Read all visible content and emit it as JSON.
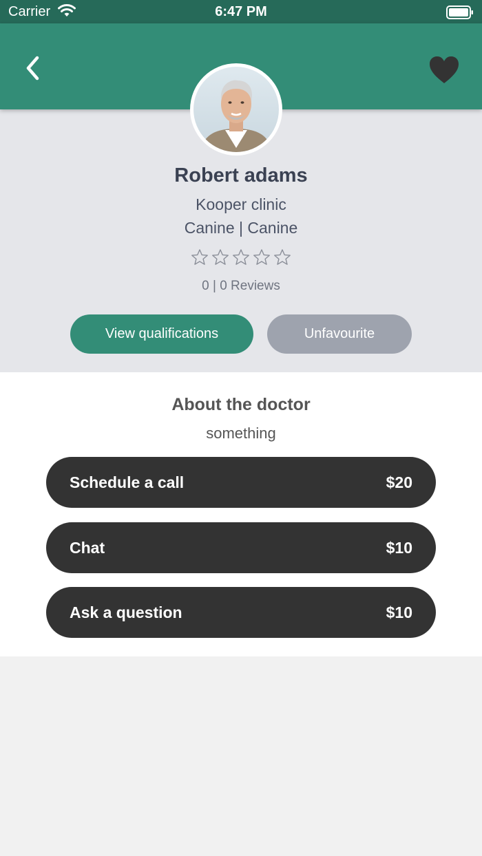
{
  "status_bar": {
    "carrier": "Carrier",
    "time": "6:47 PM"
  },
  "colors": {
    "accent": "#338d77",
    "status_bar": "#266a59",
    "dark_button": "#333333",
    "muted_button": "#9ea3ae"
  },
  "header": {
    "back_icon": "chevron-left-icon",
    "favourite_icon": "heart-icon"
  },
  "profile": {
    "name": "Robert adams",
    "clinic": "Kooper clinic",
    "specialty": "Canine | Canine",
    "rating": 0,
    "rating_max": 5,
    "reviews": "0 | 0 Reviews",
    "view_qualifications_label": "View qualifications",
    "unfavourite_label": "Unfavourite"
  },
  "about": {
    "title": "About the doctor",
    "text": "something"
  },
  "services": [
    {
      "label": "Schedule a call",
      "price": "$20"
    },
    {
      "label": "Chat",
      "price": "$10"
    },
    {
      "label": "Ask a question",
      "price": "$10"
    }
  ]
}
